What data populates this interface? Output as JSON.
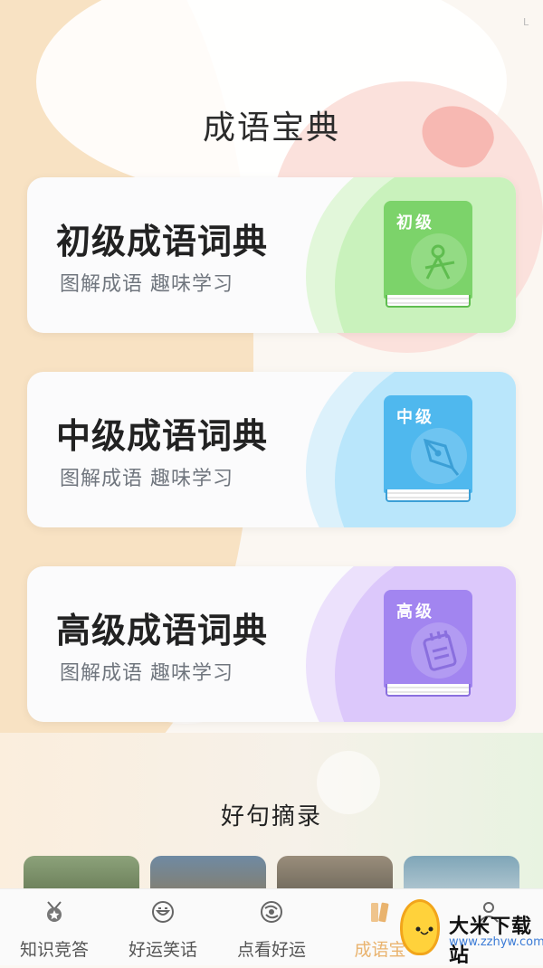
{
  "header": {
    "title": "成语宝典"
  },
  "cards": [
    {
      "title": "初级成语词典",
      "subtitle": "图解成语 趣味学习",
      "book_label": "初级",
      "icon": "compass-icon",
      "colors": {
        "accent": "#c9f2bc",
        "cover": "#7cd36a"
      }
    },
    {
      "title": "中级成语词典",
      "subtitle": "图解成语 趣味学习",
      "book_label": "中级",
      "icon": "pen-nib-icon",
      "colors": {
        "accent": "#b9e6fb",
        "cover": "#4fb8ee"
      }
    },
    {
      "title": "高级成语词典",
      "subtitle": "图解成语 趣味学习",
      "book_label": "高级",
      "icon": "notebook-icon",
      "colors": {
        "accent": "#dcc8fb",
        "cover": "#a285f0"
      }
    }
  ],
  "section": {
    "title": "好句摘录"
  },
  "nav": {
    "items": [
      {
        "label": "知识竞答",
        "icon": "medal-icon",
        "active": false
      },
      {
        "label": "好运笑话",
        "icon": "smile-icon",
        "active": false
      },
      {
        "label": "点看好运",
        "icon": "fortune-icon",
        "active": false
      },
      {
        "label": "成语宝",
        "icon": "books-icon",
        "active": true
      },
      {
        "label": "",
        "icon": "user-icon",
        "active": false
      }
    ]
  },
  "watermark": {
    "title": "大米下载站",
    "url": "www.zzhyw.com"
  },
  "status": {
    "mark": "L"
  },
  "colors": {
    "active_tab": "#e9b36e",
    "background": "#fbf7f2"
  }
}
